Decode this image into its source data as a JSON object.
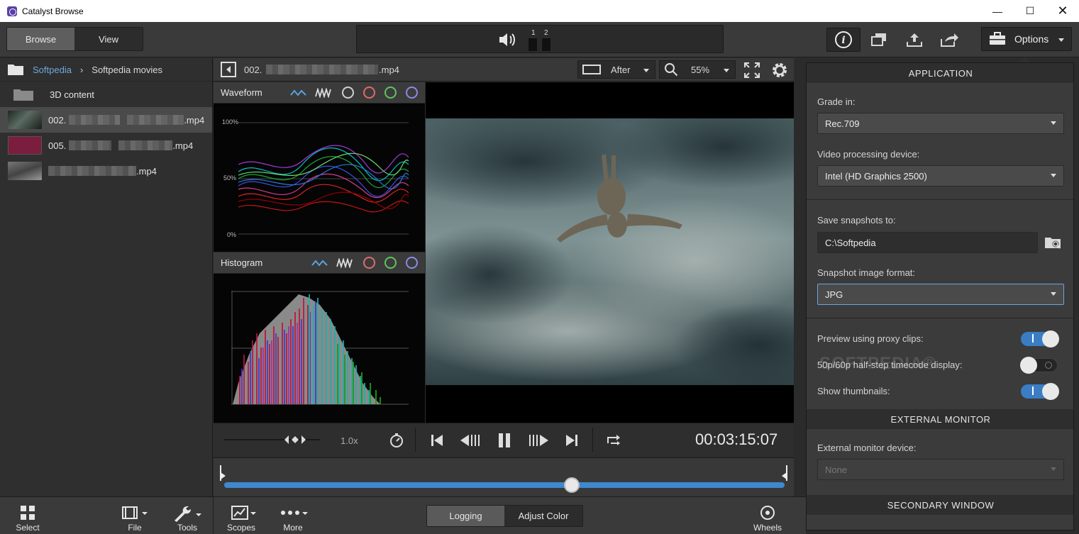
{
  "window": {
    "title": "Catalyst Browse"
  },
  "toolbar": {
    "tabs": [
      {
        "label": "Browse"
      },
      {
        "label": "View"
      }
    ],
    "audio_channels": [
      "1",
      "2"
    ],
    "options_label": "Options"
  },
  "browser": {
    "breadcrumb_root": "Softpedia",
    "breadcrumb_current": "Softpedia movies",
    "folder": "3D content",
    "files": [
      {
        "prefix": "002.",
        "suffix": ".mp4"
      },
      {
        "prefix": "005.",
        "suffix": ".mp4"
      },
      {
        "prefix": "",
        "suffix": ".mp4"
      }
    ]
  },
  "viewer": {
    "clip_prefix": "002.",
    "clip_suffix": ".mp4",
    "view_mode": "After",
    "zoom": "55%"
  },
  "scopes": {
    "waveform": {
      "title": "Waveform",
      "ticks": [
        "100%",
        "50%",
        "0%"
      ]
    },
    "histogram": {
      "title": "Histogram"
    }
  },
  "transport": {
    "speed": "1.0x",
    "timecode": "00:03:15:07",
    "playhead_fraction": 0.62
  },
  "bottom": {
    "left_items": [
      {
        "label": "Select"
      },
      {
        "label": "File"
      },
      {
        "label": "Tools"
      }
    ],
    "center_items": [
      {
        "label": "Scopes"
      },
      {
        "label": "More"
      }
    ],
    "mode_tabs": [
      {
        "label": "Logging"
      },
      {
        "label": "Adjust Color"
      }
    ],
    "wheels_label": "Wheels"
  },
  "options": {
    "application_head": "APPLICATION",
    "grade_in_label": "Grade in:",
    "grade_in_value": "Rec.709",
    "device_label": "Video processing device:",
    "device_value": "Intel (HD Graphics 2500)",
    "snapshots_label": "Save snapshots to:",
    "snapshots_value": "C:\\Softpedia",
    "format_label": "Snapshot image format:",
    "format_value": "JPG",
    "proxy_label": "Preview using proxy clips:",
    "proxy_on": true,
    "halfstep_label": "50p/60p half-step timecode display:",
    "halfstep_on": false,
    "thumbs_label": "Show thumbnails:",
    "thumbs_on": true,
    "external_head": "EXTERNAL MONITOR",
    "external_label": "External monitor device:",
    "external_value": "None",
    "secondary_head": "SECONDARY WINDOW",
    "watermark": "SOFTPEDIA®"
  },
  "colors": {
    "accent": "#3a7dc4",
    "link": "#6ea8dc"
  }
}
